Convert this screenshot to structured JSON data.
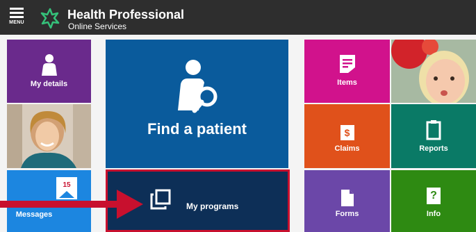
{
  "header": {
    "menu_label": "MENU",
    "title_line1": "Health Professional",
    "title_line2": "Online Services"
  },
  "tiles": {
    "my_details": "My details",
    "find_patient": "Find a patient",
    "messages": "Messages",
    "messages_badge": "15",
    "my_programs": "My programs",
    "items": "Items",
    "claims": "Claims",
    "claims_icon": "$",
    "reports": "Reports",
    "forms": "Forms",
    "info": "Info",
    "info_icon": "?"
  },
  "icons": [
    "menu-icon",
    "logo-icon",
    "person-icon",
    "find-patient-icon",
    "message-icon",
    "programs-icon",
    "items-icon",
    "claims-icon",
    "reports-icon",
    "forms-icon",
    "info-icon",
    "annotation-arrow"
  ],
  "colors": {
    "topbar": "#2e2e2e",
    "purple": "#6a2a8c",
    "blue": "#0a5b9c",
    "navy": "#0d2f57",
    "magenta": "#d1128c",
    "orange": "#e0511b",
    "green_dark": "#0a7a66",
    "green": "#2e8a12",
    "violet": "#6b47a8",
    "msg_blue": "#1c86e0",
    "arrow_red": "#c8102e"
  }
}
